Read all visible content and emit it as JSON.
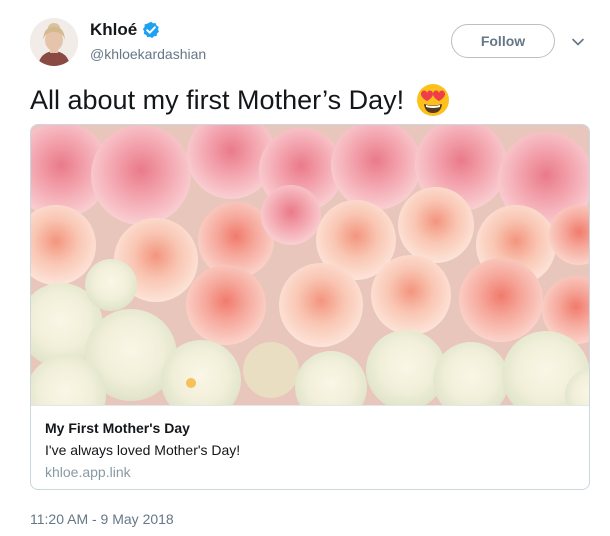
{
  "user": {
    "display_name": "Khloé",
    "handle": "@khloekardashian",
    "verified": true,
    "verified_color": "#1da1f2"
  },
  "follow_button": {
    "label": "Follow"
  },
  "menu_icon": "chevron-down-icon",
  "tweet": {
    "text": "All about my first Mother’s Day!",
    "emoji": "smiling-face-with-heart-eyes"
  },
  "card": {
    "image_description_icon": "roses-photo",
    "title": "My First Mother's Day",
    "description": "I've always loved Mother's Day!",
    "domain": "khloe.app.link"
  },
  "timestamp": "11:20 AM - 9 May 2018",
  "colors": {
    "text": "#14171a",
    "secondary": "#657786",
    "border": "#ccd6dd",
    "link_domain": "#8899a6"
  }
}
